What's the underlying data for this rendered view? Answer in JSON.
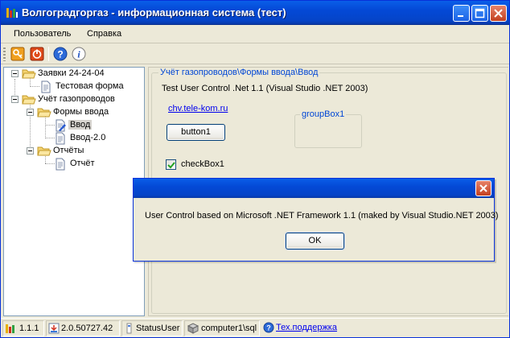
{
  "window": {
    "title": "Волгоградгоргаз - информационная система (тест)",
    "accent": "#0449d6"
  },
  "menu": [
    {
      "label": "Пользователь"
    },
    {
      "label": "Справка"
    }
  ],
  "toolbar": {
    "icons": [
      "key-icon",
      "power-icon",
      "help-icon",
      "info-icon"
    ]
  },
  "tree": {
    "nodes": [
      {
        "label": "Заявки 24-24-04"
      },
      {
        "label": "Тестовая форма"
      },
      {
        "label": "Учёт газопроводов"
      },
      {
        "label": "Формы ввода"
      },
      {
        "label": "Ввод"
      },
      {
        "label": "Ввод-2.0"
      },
      {
        "label": "Отчёты"
      },
      {
        "label": "Отчёт"
      }
    ]
  },
  "content": {
    "breadcrumb": "Учёт газопроводов\\Формы ввода\\Ввод",
    "header": "Test User Control .Net 1.1 (Visual Studio .NET 2003)",
    "link": "chv.tele-kom.ru",
    "button1": "button1",
    "groupbox": "groupBox1",
    "checkbox_label": "checkBox1",
    "checkbox_checked": true
  },
  "dialog": {
    "message": "User Control based on Microsoft .NET Framework 1.1 (maked by Visual Studio.NET 2003)",
    "ok": "OK"
  },
  "status": {
    "version": "1.1.1",
    "framework": "2.0.50727.42",
    "user": "StatusUser",
    "server": "computer1\\sql",
    "support": "Тех.поддержка"
  }
}
